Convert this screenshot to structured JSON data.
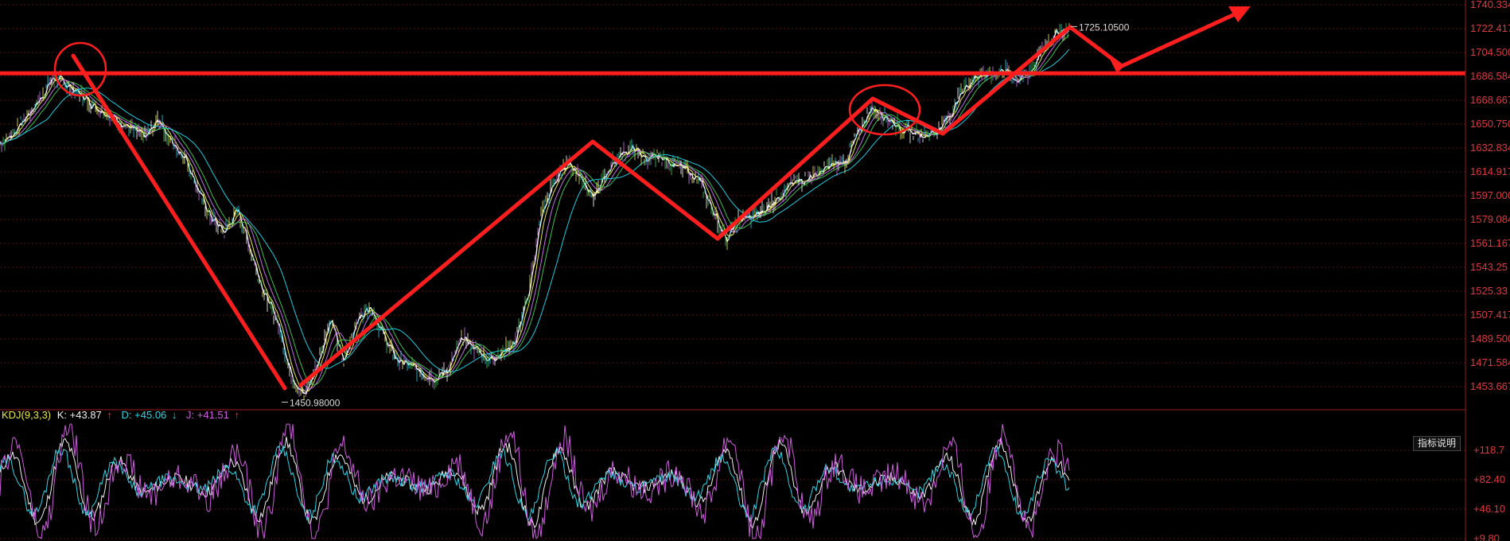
{
  "colors": {
    "background": "#000000",
    "grid": "#5a1111",
    "frame": "#9e1b1b",
    "axis_text": "#e0393b",
    "annotation": "#ff1e1e",
    "ma_fast": "#f5f5f5",
    "ma_2": "#e8e84a",
    "ma_3": "#c46ee6",
    "ma_4": "#39c24a",
    "ma_5": "#1ecde0",
    "k_line": "#f0f0f0",
    "d_line": "#2fd5e6",
    "j_line": "#d05be0"
  },
  "price_axis_labels": [
    "1740.334",
    "1722.4175",
    "1704.500",
    "1686.584",
    "1668.6675",
    "1650.7508",
    "1632.834",
    "1614.9175",
    "1597.000",
    "1579.084",
    "1561.1675",
    "1543.25",
    "1525.33",
    "1507.4175",
    "1489.500",
    "1471.584",
    "1453.6675"
  ],
  "kdj_axis_labels": [
    "+118.7",
    "+82.40",
    "+46.10",
    "+9.80"
  ],
  "kdj_header": {
    "name": "KDJ(9,3,3)",
    "k": "K: +43.87",
    "k_arrow": "↑",
    "d": "D: +45.06",
    "d_arrow": "↓",
    "j": "J: +41.51",
    "j_arrow": "↑"
  },
  "explain_button": "指标说明",
  "chart_data": [
    {
      "type": "line",
      "panel": "price",
      "ylim": [
        1446,
        1741
      ],
      "series": [
        {
          "values": [
            1640,
            1647,
            1660,
            1672,
            1688,
            1683,
            1676,
            1668,
            1662,
            1656,
            1650,
            1644,
            1658,
            1640,
            1630,
            1605,
            1585,
            1575,
            1592,
            1560,
            1530,
            1510,
            1472,
            1455,
            1478,
            1512,
            1480,
            1510,
            1522,
            1500,
            1482,
            1478,
            1472,
            1468,
            1476,
            1498,
            1490,
            1482,
            1487,
            1495,
            1530,
            1588,
            1612,
            1626,
            1615,
            1600,
            1620,
            1632,
            1636,
            1628,
            1630,
            1625,
            1620,
            1612,
            1590,
            1570,
            1585,
            1586,
            1592,
            1602,
            1610,
            1614,
            1618,
            1624,
            1626,
            1648,
            1666,
            1660,
            1652,
            1648,
            1646,
            1649,
            1662,
            1680,
            1690,
            1690,
            1694,
            1686,
            1692,
            1708,
            1721,
            1724
          ]
        }
      ],
      "points": [
        {
          "label": "1450.98000",
          "value": 1450.98
        },
        {
          "label": "1725.10500",
          "value": 1725.105
        }
      ],
      "horizontal_line": 1691
    },
    {
      "type": "line",
      "panel": "KDJ",
      "ylim": [
        -5,
        125
      ],
      "series": [
        {
          "name": "K",
          "seed": 11
        },
        {
          "name": "D",
          "seed": 29
        },
        {
          "name": "J",
          "seed": 47
        }
      ]
    }
  ]
}
